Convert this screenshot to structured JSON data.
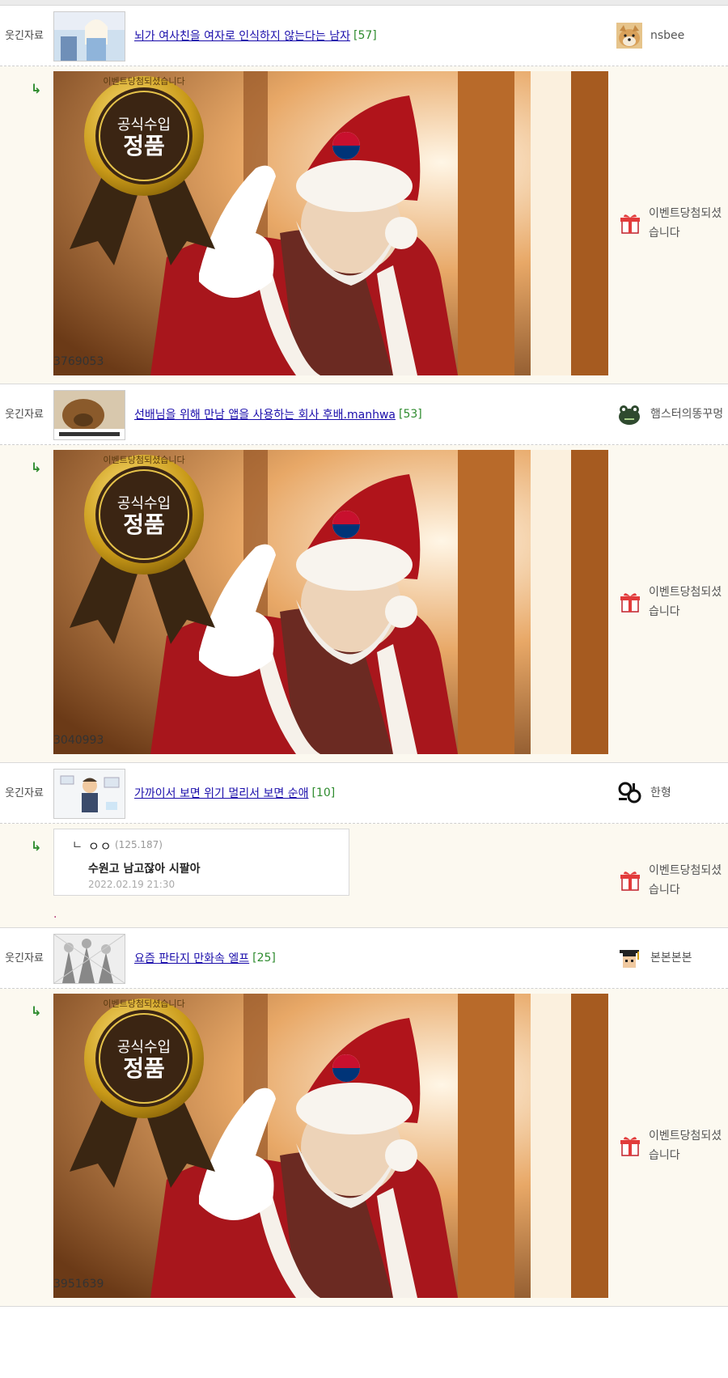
{
  "posts": [
    {
      "category": "웃긴자료",
      "title": "뇌가 여사친을 여자로 인식하지 않는다는 남자",
      "comment_count": "[57]",
      "author": "nsbee",
      "author_icon": "shiba-dog-avatar-icon",
      "reply": {
        "arrow": "↳",
        "number": "3769053",
        "author": "이벤트당첨되셨습니다",
        "author_icon": "gift-box-icon"
      }
    },
    {
      "category": "웃긴자료",
      "title": "선배님을 위해 만남 앱을 사용하는 회사 후배.manhwa",
      "comment_count": "[53]",
      "author": "햄스터의똥꾸멍",
      "author_icon": "green-frog-pixel-icon",
      "reply": {
        "arrow": "↳",
        "number": "3040993",
        "author": "이벤트당첨되셨습니다",
        "author_icon": "gift-box-icon"
      }
    },
    {
      "category": "웃긴자료",
      "title": "가까이서 보면 위기 멀리서 보면 순애",
      "comment_count": "[10]",
      "author": "한형",
      "author_icon": "hanhyung-black-logo-icon",
      "reply": {
        "arrow": "↳",
        "comment": {
          "arrow": "ㄴ",
          "name": "ㅇㅇ",
          "ip": "(125.187)",
          "text": "수원고 남고잖아 시팔아",
          "date": "2022.02.19 21:30"
        },
        "dot": ".",
        "author": "이벤트당첨되셨습니다",
        "author_icon": "gift-box-icon"
      }
    },
    {
      "category": "웃긴자료",
      "title": "요즘 판타지 만화속 엘프",
      "comment_count": "[25]",
      "author": "본본본본",
      "author_icon": "graduation-cap-pixel-avatar-icon",
      "reply": {
        "arrow": "↳",
        "number": "3951639",
        "author": "이벤트당첨되셨습니다",
        "author_icon": "gift-box-icon"
      }
    }
  ],
  "banner": {
    "badge_line1": "공식수입",
    "badge_line2": "정품",
    "badge_ring_text": "이벤트당첨되셨습니다"
  }
}
